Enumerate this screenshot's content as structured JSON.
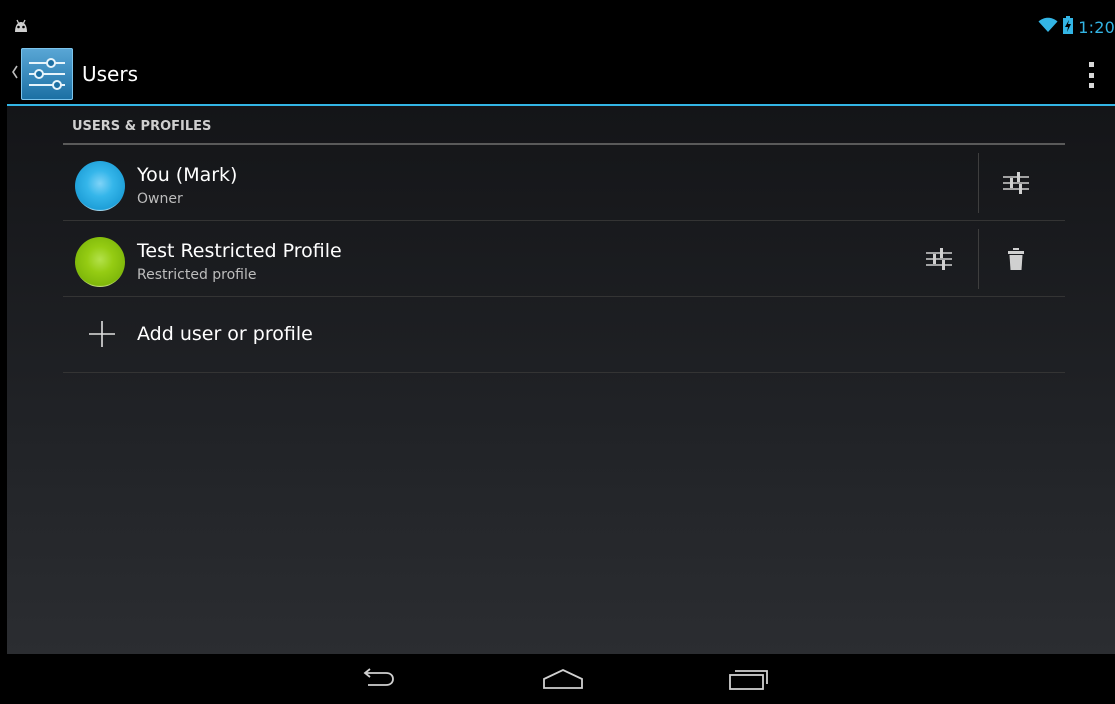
{
  "status_bar": {
    "time": "1:20",
    "icons": [
      "android-notification-icon",
      "wifi-icon",
      "battery-charging-icon"
    ]
  },
  "action_bar": {
    "title": "Users",
    "icons": [
      "up-caret-icon",
      "settings-app-icon",
      "overflow-menu-icon"
    ]
  },
  "section": {
    "header": "USERS & PROFILES"
  },
  "users": [
    {
      "name": "You (Mark)",
      "role": "Owner",
      "avatar_color": "#33b5e5",
      "actions": [
        "settings-sliders-icon"
      ]
    },
    {
      "name": "Test Restricted Profile",
      "role": "Restricted profile",
      "avatar_color": "#99cc00",
      "actions": [
        "settings-sliders-icon",
        "trash-icon"
      ]
    }
  ],
  "add": {
    "label": "Add user or profile",
    "icon": "plus-icon"
  },
  "nav_bar": {
    "buttons": [
      "back-icon",
      "home-icon",
      "recents-icon"
    ]
  },
  "colors": {
    "accent": "#33b5e5"
  }
}
